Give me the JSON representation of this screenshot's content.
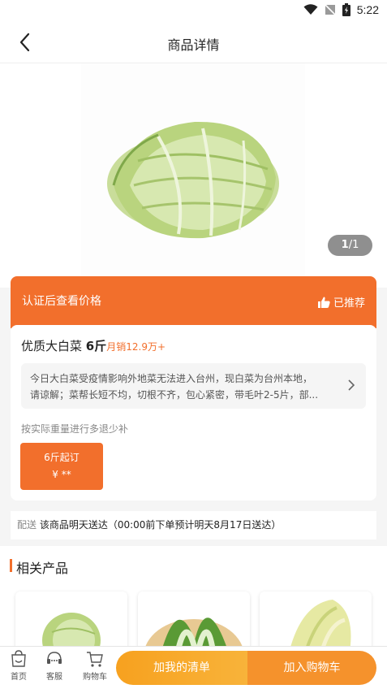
{
  "status_bar": {
    "time": "5:22"
  },
  "header": {
    "title": "商品详情"
  },
  "gallery": {
    "current": "1",
    "separator": "/",
    "total": "1"
  },
  "price_bar": {
    "login_to_view": "认证后查看价格",
    "recommended": "已推荐"
  },
  "product": {
    "name": "优质大白菜",
    "spec": "6斤",
    "monthly_sales": "月销12.9万+",
    "description_line1": "今日大白菜受疫情影响外地菜无法进入台州，现白菜为台州本地，",
    "description_line2": "请谅解；菜帮长短不均，切根不齐，包心紧密，带毛叶2-5片，部...",
    "weight_note": "按实际重量进行多退少补",
    "tier": {
      "min_qty": "6斤起订",
      "price": "¥ **"
    }
  },
  "delivery": {
    "label": "配送",
    "text": "该商品明天送达（00:00前下单预计明天8月17日送达）"
  },
  "related": {
    "heading": "相关产品",
    "item_count": 3
  },
  "tabbar": {
    "home": "首页",
    "service": "客服",
    "cart": "购物车",
    "add_to_list": "加我的清单",
    "add_to_cart": "加入购物车"
  },
  "colors": {
    "accent": "#f26f2c",
    "list_button": "#f7a11f",
    "cart_button": "#f5922c"
  }
}
